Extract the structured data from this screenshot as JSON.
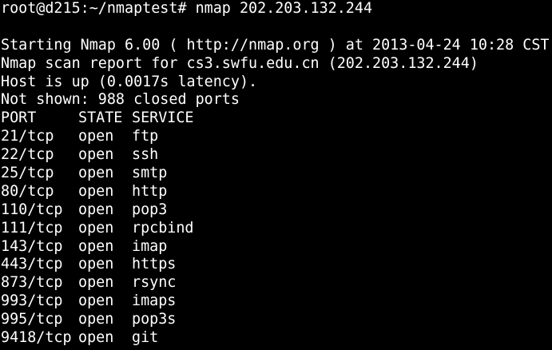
{
  "prompt": {
    "text": "root@d215:~/nmaptest# nmap 202.203.132.244"
  },
  "output": {
    "starting": "Starting Nmap 6.00 ( http://nmap.org ) at 2013-04-24 10:28 CST",
    "report": "Nmap scan report for cs3.swfu.edu.cn (202.203.132.244)",
    "host_up": "Host is up (0.0017s latency).",
    "not_shown": "Not shown: 988 closed ports"
  },
  "table": {
    "headers": {
      "port": "PORT",
      "state": "STATE",
      "service": "SERVICE"
    },
    "rows": [
      {
        "port": "21/tcp",
        "state": "open",
        "service": "ftp"
      },
      {
        "port": "22/tcp",
        "state": "open",
        "service": "ssh"
      },
      {
        "port": "25/tcp",
        "state": "open",
        "service": "smtp"
      },
      {
        "port": "80/tcp",
        "state": "open",
        "service": "http"
      },
      {
        "port": "110/tcp",
        "state": "open",
        "service": "pop3"
      },
      {
        "port": "111/tcp",
        "state": "open",
        "service": "rpcbind"
      },
      {
        "port": "143/tcp",
        "state": "open",
        "service": "imap"
      },
      {
        "port": "443/tcp",
        "state": "open",
        "service": "https"
      },
      {
        "port": "873/tcp",
        "state": "open",
        "service": "rsync"
      },
      {
        "port": "993/tcp",
        "state": "open",
        "service": "imaps"
      },
      {
        "port": "995/tcp",
        "state": "open",
        "service": "pop3s"
      },
      {
        "port": "9418/tcp",
        "state": "open",
        "service": "git"
      }
    ]
  },
  "colors": {
    "background": "#000000",
    "foreground": "#ffffff"
  }
}
